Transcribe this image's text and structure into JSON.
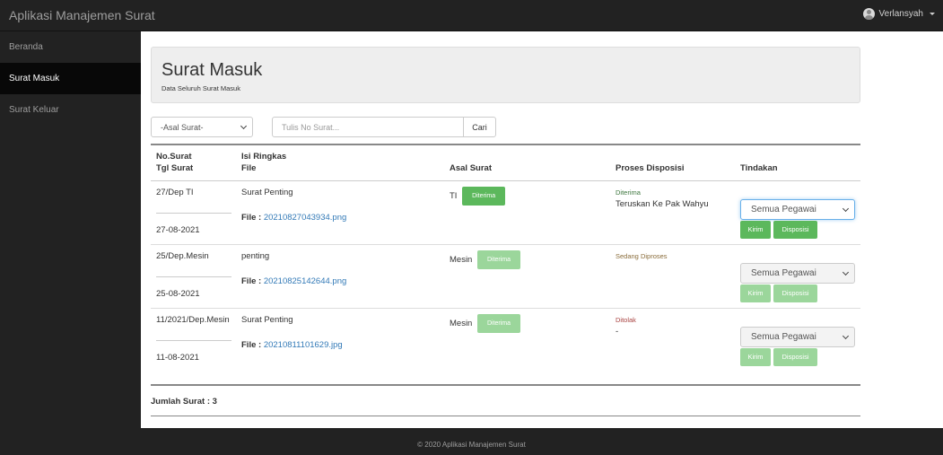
{
  "app": {
    "title": "Aplikasi Manajemen Surat",
    "user": "Verlansyah"
  },
  "sidebar": {
    "items": [
      {
        "label": "Beranda"
      },
      {
        "label": "Surat Masuk"
      },
      {
        "label": "Surat Keluar"
      }
    ]
  },
  "page": {
    "title": "Surat Masuk",
    "subtitle": "Data Seluruh Surat Masuk"
  },
  "filters": {
    "source_select": "-Asal Surat-",
    "search_placeholder": "Tulis No Surat...",
    "search_button": "Cari"
  },
  "table": {
    "headers": {
      "no_surat": "No.Surat",
      "tgl_surat": "Tgl Surat",
      "isi_ringkas": "Isi Ringkas",
      "file": "File",
      "asal_surat": "Asal Surat",
      "proses_disposisi": "Proses Disposisi",
      "tindakan": "Tindakan"
    },
    "file_label": "File :",
    "rows": [
      {
        "no": "27/Dep TI",
        "date": "27-08-2021",
        "summary": "Surat Penting",
        "file": "20210827043934.png",
        "source": "TI",
        "accept_label": "Diterima",
        "status": "Diterima",
        "note": "Teruskan Ke Pak Wahyu",
        "select": "Semua Pegawai",
        "send_label": "Kirim",
        "dispose_label": "Disposisi"
      },
      {
        "no": "25/Dep.Mesin",
        "date": "25-08-2021",
        "summary": "penting",
        "file": "20210825142644.png",
        "source": "Mesin",
        "accept_label": "Diterima",
        "status": "Sedang Diproses",
        "note": "",
        "select": "Semua Pegawai",
        "send_label": "Kirim",
        "dispose_label": "Disposisi"
      },
      {
        "no": "11/2021/Dep.Mesin",
        "date": "11-08-2021",
        "summary": "Surat Penting",
        "file": "20210811101629.jpg",
        "source": "Mesin",
        "accept_label": "Diterima",
        "status": "Ditolak",
        "note": "-",
        "select": "Semua Pegawai",
        "send_label": "Kirim",
        "dispose_label": "Disposisi"
      }
    ],
    "total": "Jumlah Surat : 3"
  },
  "footer": {
    "text": "© 2020 Aplikasi Manajemen Surat"
  }
}
